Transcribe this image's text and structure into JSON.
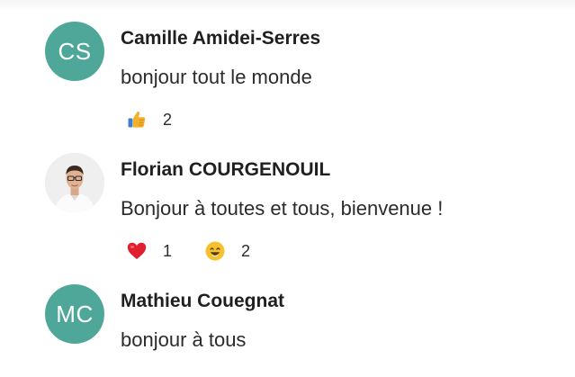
{
  "messages": [
    {
      "author": "Camille Amidei-Serres",
      "initials": "CS",
      "text": "bonjour tout le monde",
      "reactions": [
        {
          "icon": "thumbs-up-icon",
          "count": "2"
        }
      ]
    },
    {
      "author": "Florian COURGENOUIL",
      "avatar": "photo",
      "text": "Bonjour à toutes et tous, bienvenue !",
      "reactions": [
        {
          "icon": "red-heart-icon",
          "count": "1"
        },
        {
          "icon": "smiling-face-icon",
          "count": "2"
        }
      ]
    },
    {
      "author": "Mathieu Couegnat",
      "initials": "MC",
      "text": "bonjour à tous",
      "reactions": []
    }
  ],
  "colors": {
    "avatar_bg": "#4ea798",
    "heart": "#e0202e",
    "smiley": "#f5c12e",
    "thumb": "#f3b02c"
  }
}
